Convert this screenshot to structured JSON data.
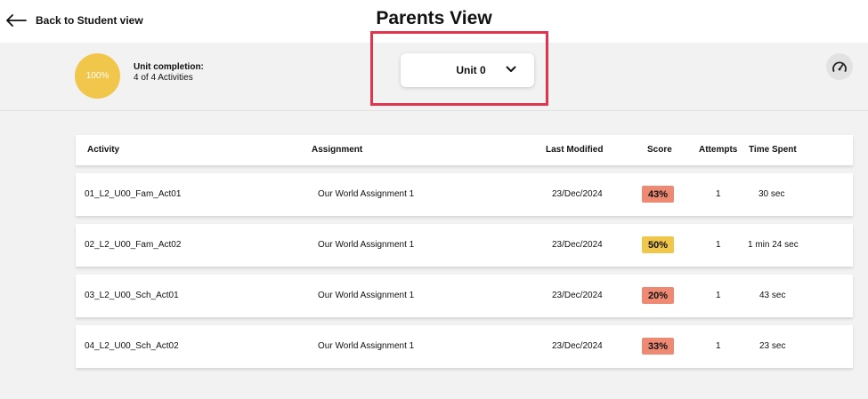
{
  "header": {
    "back_label": "Back to Student view",
    "title": "Parents View"
  },
  "summary": {
    "progress_percent": "100%",
    "completion_title": "Unit completion:",
    "completion_detail": "4 of 4 Activities",
    "progress_color": "#f0c64b"
  },
  "unit_select": {
    "selected": "Unit 0"
  },
  "table": {
    "columns": [
      "Activity",
      "Assignment",
      "Last Modified",
      "Score",
      "Attempts",
      "Time Spent"
    ],
    "rows": [
      {
        "activity": "01_L2_U00_Fam_Act01",
        "assignment": "Our World Assignment 1",
        "modified": "23/Dec/2024",
        "score": "43%",
        "score_color": "#ee8a74",
        "attempts": "1",
        "time": "30 sec"
      },
      {
        "activity": "02_L2_U00_Fam_Act02",
        "assignment": "Our World Assignment 1",
        "modified": "23/Dec/2024",
        "score": "50%",
        "score_color": "#f0c64b",
        "attempts": "1",
        "time": "1 min 24 sec"
      },
      {
        "activity": "03_L2_U00_Sch_Act01",
        "assignment": "Our World Assignment 1",
        "modified": "23/Dec/2024",
        "score": "20%",
        "score_color": "#ee8a74",
        "attempts": "1",
        "time": "43 sec"
      },
      {
        "activity": "04_L2_U00_Sch_Act02",
        "assignment": "Our World Assignment 1",
        "modified": "23/Dec/2024",
        "score": "33%",
        "score_color": "#ee8a74",
        "attempts": "1",
        "time": "23 sec"
      }
    ]
  },
  "icons": {
    "back": "arrow-left-icon",
    "dropdown": "chevron-down-icon",
    "dashboard": "gauge-icon"
  },
  "colors": {
    "highlight": "#e0344f",
    "low_score": "#ee8a74",
    "mid_score": "#f0c64b"
  }
}
